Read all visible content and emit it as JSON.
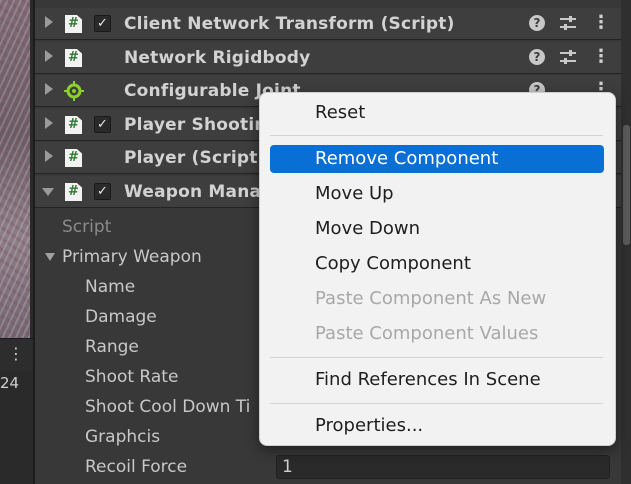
{
  "scene": {
    "menu_glyph": "⋮",
    "number": "24"
  },
  "components": [
    {
      "title": "Client Network Transform (Script)",
      "icon": "script-icon",
      "expanded": false,
      "checked": true
    },
    {
      "title": "Network Rigidbody",
      "icon": "script-icon",
      "expanded": false,
      "checked": null
    },
    {
      "title": "Configurable Joint",
      "icon": "configurable-joint-icon",
      "expanded": false,
      "checked": null
    },
    {
      "title": "Player Shooting",
      "icon": "script-icon",
      "expanded": false,
      "checked": true
    },
    {
      "title": "Player (Script)",
      "icon": "script-icon",
      "expanded": false,
      "checked": null
    },
    {
      "title": "Weapon Manag",
      "icon": "script-icon",
      "expanded": true,
      "checked": true
    }
  ],
  "component_controls": {
    "help_glyph": "?",
    "menu_glyph": "⋮",
    "check_glyph": "✓",
    "script_glyph": "#"
  },
  "properties": {
    "script_label": "Script",
    "section_label": "Primary Weapon",
    "fields": [
      {
        "label": "Name"
      },
      {
        "label": "Damage"
      },
      {
        "label": "Range"
      },
      {
        "label": "Shoot Rate"
      },
      {
        "label": "Shoot Cool Down Ti"
      },
      {
        "label": "Graphcis"
      },
      {
        "label": "Recoil Force",
        "value": "1"
      }
    ]
  },
  "context_menu": {
    "items": [
      {
        "label": "Reset",
        "state": "normal"
      },
      {
        "label": "Remove Component",
        "state": "highlighted"
      },
      {
        "label": "Move Up",
        "state": "normal"
      },
      {
        "label": "Move Down",
        "state": "normal"
      },
      {
        "label": "Copy Component",
        "state": "normal"
      },
      {
        "label": "Paste Component As New",
        "state": "disabled"
      },
      {
        "label": "Paste Component Values",
        "state": "disabled"
      },
      {
        "label": "Find References In Scene",
        "state": "normal"
      },
      {
        "label": "Properties...",
        "state": "normal"
      }
    ]
  },
  "colors": {
    "background": "#383838",
    "highlight": "#0a6fd4",
    "menu_background": "#f2f2f2",
    "joint_icon": "#8bd22b"
  }
}
